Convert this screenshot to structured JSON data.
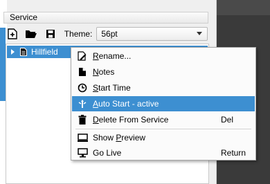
{
  "panel": {
    "header": "Service"
  },
  "toolbar": {
    "theme_label": "Theme:",
    "theme_value": "56pt"
  },
  "tree": {
    "item_label": "Hillfield"
  },
  "context_menu": {
    "items": [
      {
        "prefix": "R",
        "rest": "ename...",
        "shortcut": "",
        "icon": "rename-icon"
      },
      {
        "prefix": "N",
        "rest": "otes",
        "shortcut": "",
        "icon": "notes-icon"
      },
      {
        "prefix": "S",
        "rest": "tart Time",
        "shortcut": "",
        "icon": "clock-icon"
      },
      {
        "prefix": "A",
        "rest": "uto Start - active",
        "shortcut": "",
        "icon": "auto-start-icon"
      },
      {
        "prefix": "D",
        "rest": "elete From Service",
        "shortcut": "Del",
        "icon": "trash-icon"
      },
      {
        "prefix": "Show ",
        "underline": "P",
        "rest": "review",
        "shortcut": "",
        "icon": "preview-icon"
      },
      {
        "prefix": "Go Live",
        "rest": "",
        "shortcut": "Return",
        "icon": "go-live-icon"
      }
    ]
  },
  "colors": {
    "accent": "#3d8fd1",
    "menu_bg": "#fbfbfb",
    "dark_area": "#3a3a3a"
  }
}
